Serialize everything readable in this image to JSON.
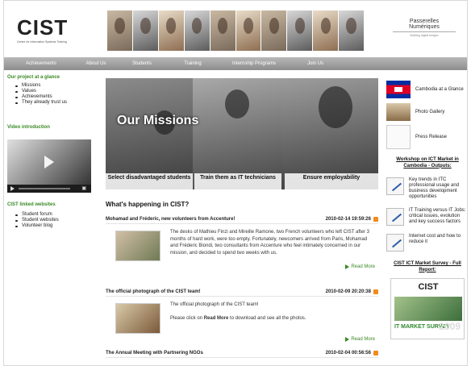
{
  "header": {
    "logo_mark": "CIST",
    "logo_subtitle": "Centre for Information Systems Training",
    "partner_line1": "Passerelles",
    "partner_line2": "Numériques",
    "partner_tagline": "Building digital bridges"
  },
  "nav": [
    "Achievements",
    "About Us",
    "Students",
    "Training",
    "Internship Programs",
    "Join Us"
  ],
  "left": {
    "glance_title": "Our project at a glance",
    "glance_items": [
      "Missions",
      "Values",
      "Achievements",
      "They already trust us"
    ],
    "video_title": "Video introduction",
    "websites_title": "CIST linked websites",
    "websites_items": [
      "Student forum",
      "Student websites",
      "Volunteer blog"
    ]
  },
  "banner": {
    "title": "Our Missions",
    "captions": [
      "Select disadvantaged students",
      "Train them as IT technicians",
      "Ensure employability"
    ]
  },
  "main": {
    "heading": "What's happening in CIST?",
    "news": [
      {
        "title": "Mohamad and Fréderic, new volunteers from Accenture!",
        "date": "2010-02-14 19:59:26",
        "body": "The desks of Mathieu Finzi and Mireille Ramone, two French volunteers who left CIST after 3 months of hard work, were too empty. Fortunately, newcomers arrived from Paris, Mohamad and Fréderic Biondi, two consultants from Accenture who feel intimately concerned in our mission, and decided to spend two weeks with us.",
        "more": "Read More"
      },
      {
        "title": "The official photograph of the CIST team!",
        "date": "2010-02-09 20:20:38",
        "body1": "The official photograph of the CIST team!",
        "body2_prefix": "Please click on ",
        "body2_bold": "Read More",
        "body2_suffix": " to download and see all the photos.",
        "more": "Read More"
      },
      {
        "title": "The Annual Meeting with Partnering NGOs",
        "date": "2010-02-04 00:56:56"
      }
    ]
  },
  "right": {
    "links": [
      "Cambodia at a Glance",
      "Photo Gallery",
      "Press Release"
    ],
    "workshop_title": "Workshop on ICT Market in Cambodia - Outputs:",
    "workshop_items": [
      "Key trends in ITC professional usage and business development opportunities",
      "IT Training versus IT Jobs: critical issues, evolution and key success factors",
      "Internet cost and how to reduce it"
    ],
    "survey_title": "CIST ICT Market Survey - Full Report:",
    "survey_logo": "CIST",
    "survey_label": "IT MARKET SURVEY",
    "survey_year": "2009"
  }
}
